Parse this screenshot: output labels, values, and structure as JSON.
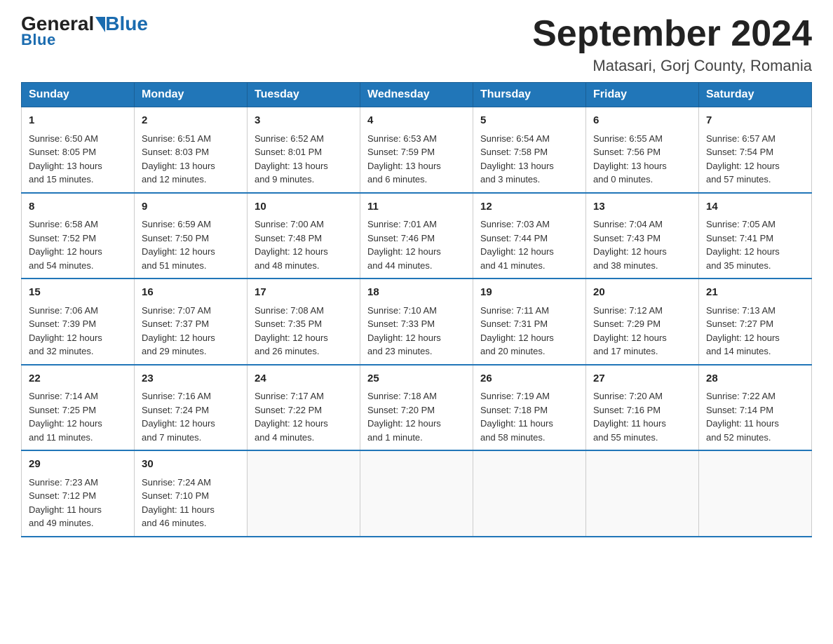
{
  "header": {
    "logo_general": "General",
    "logo_blue": "Blue",
    "title": "September 2024",
    "subtitle": "Matasari, Gorj County, Romania"
  },
  "days_of_week": [
    "Sunday",
    "Monday",
    "Tuesday",
    "Wednesday",
    "Thursday",
    "Friday",
    "Saturday"
  ],
  "weeks": [
    [
      {
        "num": "1",
        "info": "Sunrise: 6:50 AM\nSunset: 8:05 PM\nDaylight: 13 hours\nand 15 minutes."
      },
      {
        "num": "2",
        "info": "Sunrise: 6:51 AM\nSunset: 8:03 PM\nDaylight: 13 hours\nand 12 minutes."
      },
      {
        "num": "3",
        "info": "Sunrise: 6:52 AM\nSunset: 8:01 PM\nDaylight: 13 hours\nand 9 minutes."
      },
      {
        "num": "4",
        "info": "Sunrise: 6:53 AM\nSunset: 7:59 PM\nDaylight: 13 hours\nand 6 minutes."
      },
      {
        "num": "5",
        "info": "Sunrise: 6:54 AM\nSunset: 7:58 PM\nDaylight: 13 hours\nand 3 minutes."
      },
      {
        "num": "6",
        "info": "Sunrise: 6:55 AM\nSunset: 7:56 PM\nDaylight: 13 hours\nand 0 minutes."
      },
      {
        "num": "7",
        "info": "Sunrise: 6:57 AM\nSunset: 7:54 PM\nDaylight: 12 hours\nand 57 minutes."
      }
    ],
    [
      {
        "num": "8",
        "info": "Sunrise: 6:58 AM\nSunset: 7:52 PM\nDaylight: 12 hours\nand 54 minutes."
      },
      {
        "num": "9",
        "info": "Sunrise: 6:59 AM\nSunset: 7:50 PM\nDaylight: 12 hours\nand 51 minutes."
      },
      {
        "num": "10",
        "info": "Sunrise: 7:00 AM\nSunset: 7:48 PM\nDaylight: 12 hours\nand 48 minutes."
      },
      {
        "num": "11",
        "info": "Sunrise: 7:01 AM\nSunset: 7:46 PM\nDaylight: 12 hours\nand 44 minutes."
      },
      {
        "num": "12",
        "info": "Sunrise: 7:03 AM\nSunset: 7:44 PM\nDaylight: 12 hours\nand 41 minutes."
      },
      {
        "num": "13",
        "info": "Sunrise: 7:04 AM\nSunset: 7:43 PM\nDaylight: 12 hours\nand 38 minutes."
      },
      {
        "num": "14",
        "info": "Sunrise: 7:05 AM\nSunset: 7:41 PM\nDaylight: 12 hours\nand 35 minutes."
      }
    ],
    [
      {
        "num": "15",
        "info": "Sunrise: 7:06 AM\nSunset: 7:39 PM\nDaylight: 12 hours\nand 32 minutes."
      },
      {
        "num": "16",
        "info": "Sunrise: 7:07 AM\nSunset: 7:37 PM\nDaylight: 12 hours\nand 29 minutes."
      },
      {
        "num": "17",
        "info": "Sunrise: 7:08 AM\nSunset: 7:35 PM\nDaylight: 12 hours\nand 26 minutes."
      },
      {
        "num": "18",
        "info": "Sunrise: 7:10 AM\nSunset: 7:33 PM\nDaylight: 12 hours\nand 23 minutes."
      },
      {
        "num": "19",
        "info": "Sunrise: 7:11 AM\nSunset: 7:31 PM\nDaylight: 12 hours\nand 20 minutes."
      },
      {
        "num": "20",
        "info": "Sunrise: 7:12 AM\nSunset: 7:29 PM\nDaylight: 12 hours\nand 17 minutes."
      },
      {
        "num": "21",
        "info": "Sunrise: 7:13 AM\nSunset: 7:27 PM\nDaylight: 12 hours\nand 14 minutes."
      }
    ],
    [
      {
        "num": "22",
        "info": "Sunrise: 7:14 AM\nSunset: 7:25 PM\nDaylight: 12 hours\nand 11 minutes."
      },
      {
        "num": "23",
        "info": "Sunrise: 7:16 AM\nSunset: 7:24 PM\nDaylight: 12 hours\nand 7 minutes."
      },
      {
        "num": "24",
        "info": "Sunrise: 7:17 AM\nSunset: 7:22 PM\nDaylight: 12 hours\nand 4 minutes."
      },
      {
        "num": "25",
        "info": "Sunrise: 7:18 AM\nSunset: 7:20 PM\nDaylight: 12 hours\nand 1 minute."
      },
      {
        "num": "26",
        "info": "Sunrise: 7:19 AM\nSunset: 7:18 PM\nDaylight: 11 hours\nand 58 minutes."
      },
      {
        "num": "27",
        "info": "Sunrise: 7:20 AM\nSunset: 7:16 PM\nDaylight: 11 hours\nand 55 minutes."
      },
      {
        "num": "28",
        "info": "Sunrise: 7:22 AM\nSunset: 7:14 PM\nDaylight: 11 hours\nand 52 minutes."
      }
    ],
    [
      {
        "num": "29",
        "info": "Sunrise: 7:23 AM\nSunset: 7:12 PM\nDaylight: 11 hours\nand 49 minutes."
      },
      {
        "num": "30",
        "info": "Sunrise: 7:24 AM\nSunset: 7:10 PM\nDaylight: 11 hours\nand 46 minutes."
      },
      {
        "num": "",
        "info": ""
      },
      {
        "num": "",
        "info": ""
      },
      {
        "num": "",
        "info": ""
      },
      {
        "num": "",
        "info": ""
      },
      {
        "num": "",
        "info": ""
      }
    ]
  ]
}
